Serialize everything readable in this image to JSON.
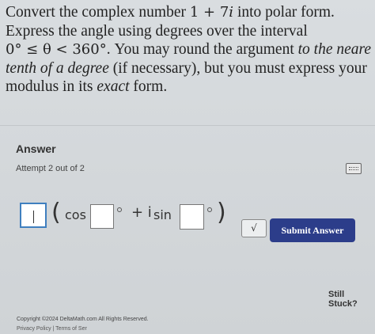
{
  "question": {
    "line1_pre": "Convert the complex number ",
    "complex_number": "1 + 7",
    "complex_i": "i",
    "line1_post": " into polar form.",
    "line2": "Express the angle using degrees over the interval",
    "interval": "0° ≤ θ < 360°",
    "line3_post": ". You may round the argument ",
    "line3_italic": "to the neare",
    "line4_italic": "tenth of a degree",
    "line4_post": " (if necessary), but you must express your",
    "line5_pre": "modulus in its ",
    "line5_italic": "exact",
    "line5_post": " form."
  },
  "answer": {
    "title": "Answer",
    "attempt": "Attempt 2 out of 2",
    "cos_label": "cos",
    "plus_i": "+ i",
    "sin_label": "sin",
    "sqrt_label": "√",
    "submit_label": "Submit Answer"
  },
  "footer": {
    "still_stuck": "Still Stuck?",
    "copyright": "Copyright ©2024 DeltaMath.com All Rights Reserved.",
    "links": "Privacy Policy | Terms of Ser"
  },
  "colors": {
    "submit_bg": "#2c3d8a",
    "active_border": "#3f7fbf"
  }
}
